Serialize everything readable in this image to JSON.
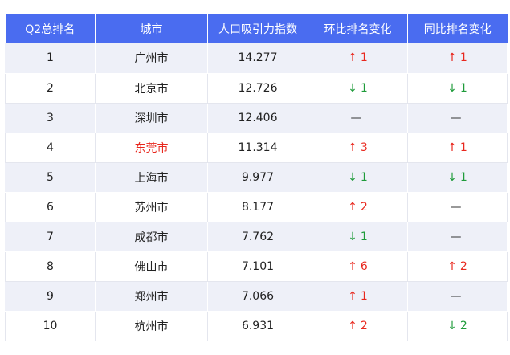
{
  "headers": [
    "Q2总排名",
    "城市",
    "人口吸引力指数",
    "环比排名变化",
    "同比排名变化"
  ],
  "colors": {
    "header_bg": "#4a6cf0",
    "up": "#e8271d",
    "down": "#1e9b3a",
    "highlight_city": "#e8271d"
  },
  "rows": [
    {
      "rank": "1",
      "city": "广州市",
      "index": "14.277",
      "mom": {
        "dir": "up",
        "arrow": "↑",
        "value": "1"
      },
      "yoy": {
        "dir": "up",
        "arrow": "↑",
        "value": "1"
      }
    },
    {
      "rank": "2",
      "city": "北京市",
      "index": "12.726",
      "mom": {
        "dir": "down",
        "arrow": "↓",
        "value": "1"
      },
      "yoy": {
        "dir": "down",
        "arrow": "↓",
        "value": "1"
      }
    },
    {
      "rank": "3",
      "city": "深圳市",
      "index": "12.406",
      "mom": {
        "dir": "flat",
        "arrow": "—",
        "value": ""
      },
      "yoy": {
        "dir": "flat",
        "arrow": "—",
        "value": ""
      }
    },
    {
      "rank": "4",
      "city": "东莞市",
      "highlight": true,
      "index": "11.314",
      "mom": {
        "dir": "up",
        "arrow": "↑",
        "value": "3"
      },
      "yoy": {
        "dir": "up",
        "arrow": "↑",
        "value": "1"
      }
    },
    {
      "rank": "5",
      "city": "上海市",
      "index": "9.977",
      "mom": {
        "dir": "down",
        "arrow": "↓",
        "value": "1"
      },
      "yoy": {
        "dir": "down",
        "arrow": "↓",
        "value": "1"
      }
    },
    {
      "rank": "6",
      "city": "苏州市",
      "index": "8.177",
      "mom": {
        "dir": "up",
        "arrow": "↑",
        "value": "2"
      },
      "yoy": {
        "dir": "flat",
        "arrow": "—",
        "value": ""
      }
    },
    {
      "rank": "7",
      "city": "成都市",
      "index": "7.762",
      "mom": {
        "dir": "down",
        "arrow": "↓",
        "value": "1"
      },
      "yoy": {
        "dir": "flat",
        "arrow": "—",
        "value": ""
      }
    },
    {
      "rank": "8",
      "city": "佛山市",
      "index": "7.101",
      "mom": {
        "dir": "up",
        "arrow": "↑",
        "value": "6"
      },
      "yoy": {
        "dir": "up",
        "arrow": "↑",
        "value": "2"
      }
    },
    {
      "rank": "9",
      "city": "郑州市",
      "index": "7.066",
      "mom": {
        "dir": "up",
        "arrow": "↑",
        "value": "1"
      },
      "yoy": {
        "dir": "flat",
        "arrow": "—",
        "value": ""
      }
    },
    {
      "rank": "10",
      "city": "杭州市",
      "index": "6.931",
      "mom": {
        "dir": "up",
        "arrow": "↑",
        "value": "2"
      },
      "yoy": {
        "dir": "down",
        "arrow": "↓",
        "value": "2"
      }
    }
  ]
}
